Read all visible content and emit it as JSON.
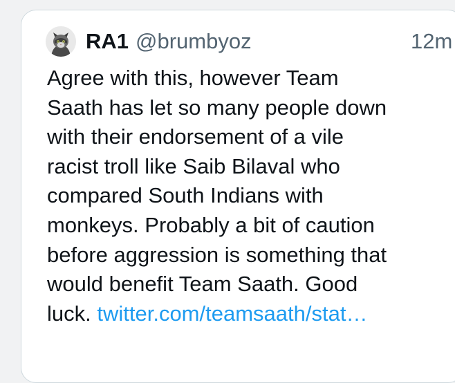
{
  "tweet": {
    "display_name": "RA1",
    "handle": "@brumbyoz",
    "timestamp": "12m",
    "avatar_icon": "cat-avatar-icon",
    "body_text": "Agree with this, however Team\nSaath has let so many people down\nwith their endorsement of a vile\nracist troll like Saib Bilaval who\ncompared South Indians with\nmonkeys. Probably a bit of caution\nbefore aggression is something that\nwould benefit Team Saath. Good\nluck. ",
    "link_text": "twitter.com/teamsaath/stat…"
  },
  "colors": {
    "text": "#0f1419",
    "secondary": "#536471",
    "link": "#1d9bf0",
    "border": "#cfd9de"
  }
}
